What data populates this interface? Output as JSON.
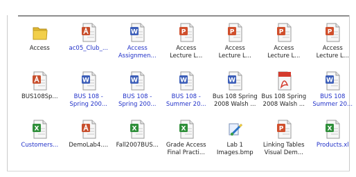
{
  "colors": {
    "text": "#222222",
    "compressed_text": "#2030c8",
    "folder": "#f2cf4a",
    "access": "#c8502e",
    "word": "#3d5fb9",
    "excel": "#2f8f3a",
    "powerpoint": "#d04f2c",
    "pdf": "#d43a2c",
    "rule": "#808080"
  },
  "files": [
    {
      "icon": "folder-icon",
      "lines": [
        "Access"
      ],
      "blue": false
    },
    {
      "icon": "access-file-icon",
      "lines": [
        "ac05_Club_..."
      ],
      "blue": true
    },
    {
      "icon": "word-file-icon",
      "lines": [
        "Access",
        "Assignmen..."
      ],
      "blue": true
    },
    {
      "icon": "powerpoint-file-icon",
      "lines": [
        "Access",
        "Lecture L..."
      ],
      "blue": false
    },
    {
      "icon": "powerpoint-file-icon",
      "lines": [
        "Access",
        "Lecture L..."
      ],
      "blue": false
    },
    {
      "icon": "powerpoint-file-icon",
      "lines": [
        "Access",
        "Lecture L..."
      ],
      "blue": false
    },
    {
      "icon": "powerpoint-file-icon",
      "lines": [
        "Access",
        "Lecture L..."
      ],
      "blue": false
    },
    {
      "icon": "access-file-icon",
      "lines": [
        "BUS108Sp..."
      ],
      "blue": false
    },
    {
      "icon": "word-file-icon",
      "lines": [
        "BUS 108 -",
        "Spring 200..."
      ],
      "blue": true
    },
    {
      "icon": "word-file-icon",
      "lines": [
        "BUS 108 -",
        "Spring 200..."
      ],
      "blue": true
    },
    {
      "icon": "word-file-icon",
      "lines": [
        "BUS 108 -",
        "Summer 20..."
      ],
      "blue": true
    },
    {
      "icon": "word-file-icon",
      "lines": [
        "Bus 108 Spring",
        "2008 Walsh ..."
      ],
      "blue": false
    },
    {
      "icon": "pdf-file-icon",
      "lines": [
        "Bus 108 Spring",
        "2008 Walsh ..."
      ],
      "blue": false
    },
    {
      "icon": "word-file-icon",
      "lines": [
        "BUS 108",
        "Summer 20..."
      ],
      "blue": true
    },
    {
      "icon": "excel-file-icon",
      "lines": [
        "Customers..."
      ],
      "blue": true
    },
    {
      "icon": "access-file-icon",
      "lines": [
        "DemoLab4...."
      ],
      "blue": false
    },
    {
      "icon": "excel-file-icon",
      "lines": [
        "Fall2007BUS..."
      ],
      "blue": false
    },
    {
      "icon": "excel-file-icon",
      "lines": [
        "Grade Access",
        "Final Practi..."
      ],
      "blue": false
    },
    {
      "icon": "image-file-icon",
      "lines": [
        "Lab 1",
        "Images.bmp"
      ],
      "blue": false
    },
    {
      "icon": "powerpoint-file-icon",
      "lines": [
        "Linking Tables",
        "Visual Dem..."
      ],
      "blue": false
    },
    {
      "icon": "excel-file-icon",
      "lines": [
        "Products.xl"
      ],
      "blue": true
    }
  ]
}
